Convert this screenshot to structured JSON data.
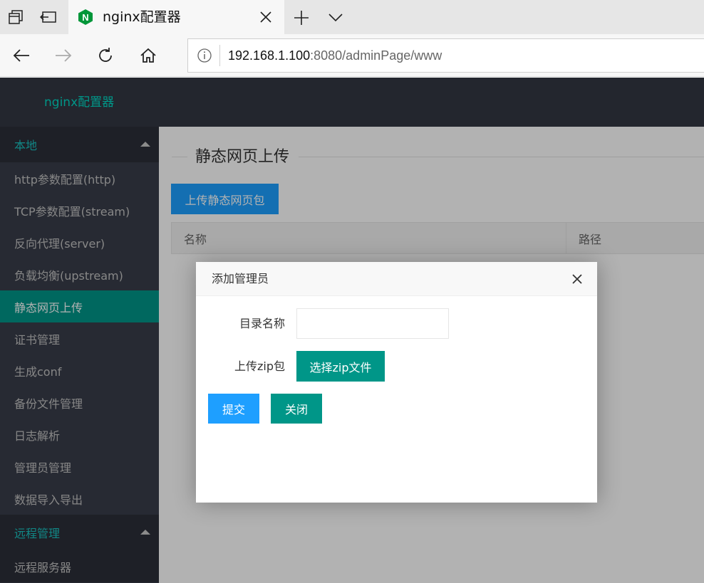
{
  "browser": {
    "tab": {
      "title": "nginx配置器",
      "favicon": "nginx-logo-icon",
      "favicon_letter": "N"
    },
    "address": {
      "host": "192.168.1.100",
      "rest": ":8080/adminPage/www"
    },
    "icons": [
      "tab-set-aside-icon",
      "tabs-back-icon",
      "close-icon",
      "plus-icon",
      "chevron-down-icon",
      "back-arrow-icon",
      "forward-arrow-icon",
      "refresh-icon",
      "home-icon",
      "info-icon"
    ]
  },
  "app": {
    "logo": "nginx配置器",
    "sidebar": {
      "group_local": "本地",
      "items": [
        "http参数配置(http)",
        "TCP参数配置(stream)",
        "反向代理(server)",
        "负载均衡(upstream)",
        "静态网页上传",
        "证书管理",
        "生成conf",
        "备份文件管理",
        "日志解析",
        "管理员管理",
        "数据导入导出"
      ],
      "active_item": "静态网页上传",
      "group_remote": "远程管理",
      "remote_items": [
        "远程服务器"
      ]
    },
    "main": {
      "section_title": "静态网页上传",
      "upload_button": "上传静态网页包",
      "table_headers": [
        "名称",
        "路径"
      ]
    },
    "modal": {
      "title": "添加管理员",
      "dir_label": "目录名称",
      "dir_value": "",
      "zip_label": "上传zip包",
      "zip_button": "选择zip文件",
      "submit": "提交",
      "close": "关闭"
    },
    "colors": {
      "accent": "#009688",
      "primary": "#1e9fff",
      "header": "#23262e",
      "sidebar": "#393d49"
    }
  }
}
